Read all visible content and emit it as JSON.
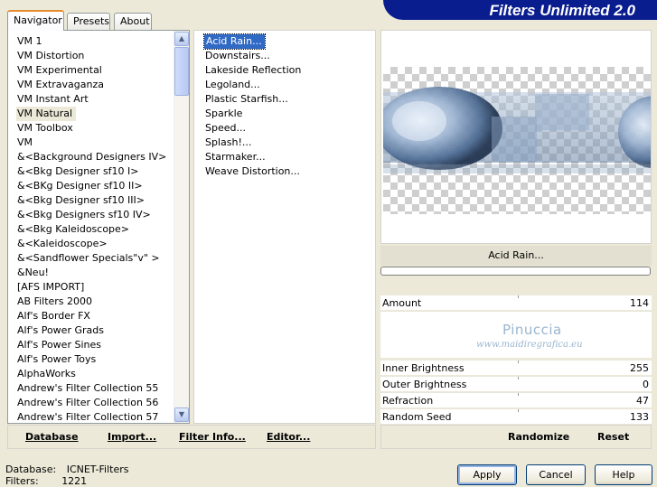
{
  "tabs": [
    "Navigator",
    "Presets",
    "About"
  ],
  "banner_title": "Filters Unlimited 2.0",
  "categories": [
    "VM 1",
    "VM Distortion",
    "VM Experimental",
    "VM Extravaganza",
    "VM Instant Art",
    "VM Natural",
    "VM Toolbox",
    "VM",
    "&<Background Designers IV>",
    "&<Bkg Designer sf10 I>",
    "&<BKg Designer sf10 II>",
    "&<Bkg Designer sf10 III>",
    "&<Bkg Designers sf10 IV>",
    "&<Bkg Kaleidoscope>",
    "&<Kaleidoscope>",
    "&<Sandflower Specials\"v\" >",
    "&Neu!",
    "[AFS IMPORT]",
    "AB Filters 2000",
    "Alf's Border FX",
    "Alf's Power Grads",
    "Alf's Power Sines",
    "Alf's Power Toys",
    "AlphaWorks",
    "Andrew's Filter Collection 55",
    "Andrew's Filter Collection 56",
    "Andrew's Filter Collection 57"
  ],
  "selected_category": "VM Natural",
  "filters": [
    "Acid Rain...",
    "Downstairs...",
    "Lakeside Reflection",
    "Legoland...",
    "Plastic Starfish...",
    "Sparkle",
    "Speed...",
    "Splash!...",
    "Starmaker...",
    "Weave Distortion..."
  ],
  "selected_filter": "Acid Rain...",
  "preview_filter_name": "Acid Rain...",
  "progress": 0,
  "params": [
    {
      "label": "Amount",
      "value": "114"
    },
    {
      "label": "Inner Brightness",
      "value": "255"
    },
    {
      "label": "Outer Brightness",
      "value": "0"
    },
    {
      "label": "Refraction",
      "value": "47"
    },
    {
      "label": "Random Seed",
      "value": "133"
    }
  ],
  "watermark": {
    "name": "Pinuccia",
    "site": "www.maidiregrafica.eu"
  },
  "left_buttons": {
    "database": "Database",
    "import": "Import...",
    "filter_info": "Filter Info...",
    "editor": "Editor..."
  },
  "right_buttons": {
    "randomize": "Randomize",
    "reset": "Reset"
  },
  "footer": {
    "database_label": "Database:",
    "database_value": "ICNET-Filters",
    "filters_label": "Filters:",
    "filters_value": "1221"
  },
  "dialog_buttons": {
    "apply": "Apply",
    "cancel": "Cancel",
    "help": "Help"
  },
  "colors": {
    "banner": "#0a1d8f",
    "selection": "#316ac5",
    "dialog_bg": "#ece9d8"
  }
}
